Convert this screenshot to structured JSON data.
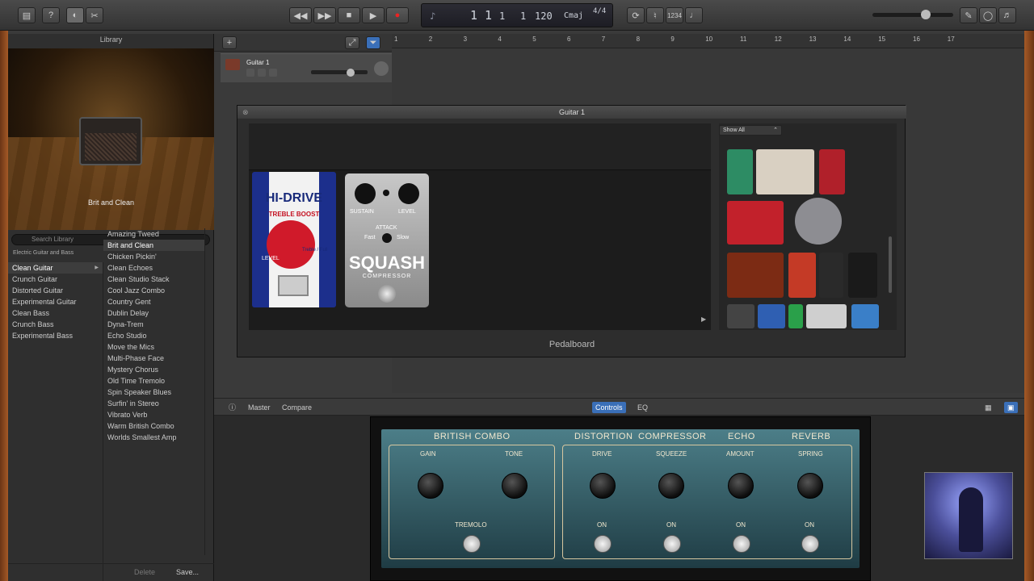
{
  "toolbar": {
    "lcd_bar": "1",
    "lcd_beat": "1",
    "lcd_div": "1",
    "lcd_tick": "1",
    "tempo": "120",
    "key": "Cmaj",
    "signature": "4/4",
    "count_in": "1234"
  },
  "library": {
    "title": "Library",
    "patch_name": "Brit and Clean",
    "search_placeholder": "Search Library",
    "breadcrumb": "Electric Guitar and Bass",
    "categories": [
      "Clean Guitar",
      "Crunch Guitar",
      "Distorted Guitar",
      "Experimental Guitar",
      "Clean Bass",
      "Crunch Bass",
      "Experimental Bass"
    ],
    "patches": [
      "Amazing Tweed",
      "Brit and Clean",
      "Chicken Pickin'",
      "Clean Echoes",
      "Clean Studio Stack",
      "Cool Jazz Combo",
      "Country Gent",
      "Dublin Delay",
      "Dyna-Trem",
      "Echo Studio",
      "Move the Mics",
      "Multi-Phase Face",
      "Mystery Chorus",
      "Old Time Tremolo",
      "Spin Speaker Blues",
      "Surfin' in Stereo",
      "Vibrato Verb",
      "Warm British Combo",
      "Worlds Smallest Amp"
    ],
    "delete_label": "Delete",
    "save_label": "Save..."
  },
  "tracks": {
    "track_name": "Guitar 1",
    "ruler": [
      "1",
      "2",
      "3",
      "4",
      "5",
      "6",
      "7",
      "8",
      "9",
      "10",
      "11",
      "12",
      "13",
      "14",
      "15",
      "16",
      "17"
    ]
  },
  "pedalboard": {
    "window_title": "Guitar 1",
    "footer": "Pedalboard",
    "show_all": "Show All",
    "hidrive": {
      "name": "HI-DRIVE",
      "sub": "TREBLE BOOST",
      "level": "LEVEL",
      "switch": "Treble / Full"
    },
    "squash": {
      "name": "SQUASH",
      "sub": "COMPRESSOR",
      "sustain": "SUSTAIN",
      "level": "LEVEL",
      "attack": "ATTACK",
      "fast": "Fast",
      "slow": "Slow"
    }
  },
  "smart_controls": {
    "master": "Master",
    "compare": "Compare",
    "controls": "Controls",
    "eq": "EQ",
    "sections": {
      "british_combo": "BRITISH COMBO",
      "distortion": "DISTORTION",
      "compressor": "COMPRESSOR",
      "echo": "ECHO",
      "reverb": "REVERB"
    },
    "knobs": {
      "gain": "GAIN",
      "tone": "TONE",
      "drive": "DRIVE",
      "squeeze": "SQUEEZE",
      "amount": "AMOUNT",
      "spring": "SPRING"
    },
    "toggles": {
      "tremolo": "TREMOLO",
      "on1": "ON",
      "on2": "ON",
      "on3": "ON",
      "on4": "ON"
    }
  }
}
